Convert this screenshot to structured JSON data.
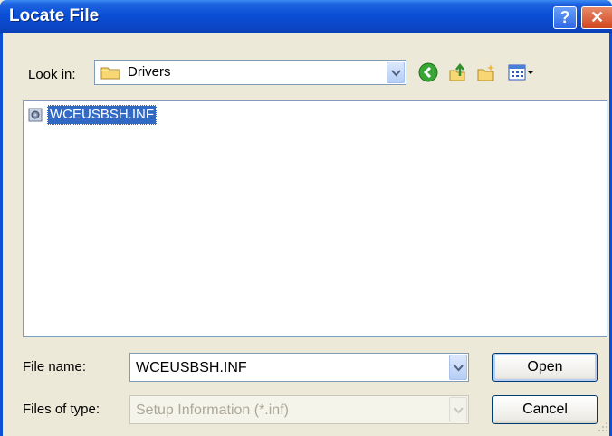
{
  "window": {
    "title": "Locate File",
    "help_glyph": "?",
    "close_glyph": "✕"
  },
  "toolbar": {
    "lookin_label": "Look in:",
    "lookin_value": "Drivers",
    "icons": [
      "back-icon",
      "up-folder-icon",
      "new-folder-icon",
      "views-menu-icon"
    ]
  },
  "files": [
    {
      "name": "WCEUSBSH.INF",
      "selected": true
    }
  ],
  "form": {
    "filename_label": "File name:",
    "filename_value": "WCEUSBSH.INF",
    "filetype_label": "Files of type:",
    "filetype_value": "Setup Information (*.inf)"
  },
  "buttons": {
    "open": "Open",
    "cancel": "Cancel"
  },
  "colors": {
    "titlebar": "#0a4fd6",
    "selection": "#316ac5",
    "face": "#ece9d8",
    "close": "#d1461e"
  }
}
